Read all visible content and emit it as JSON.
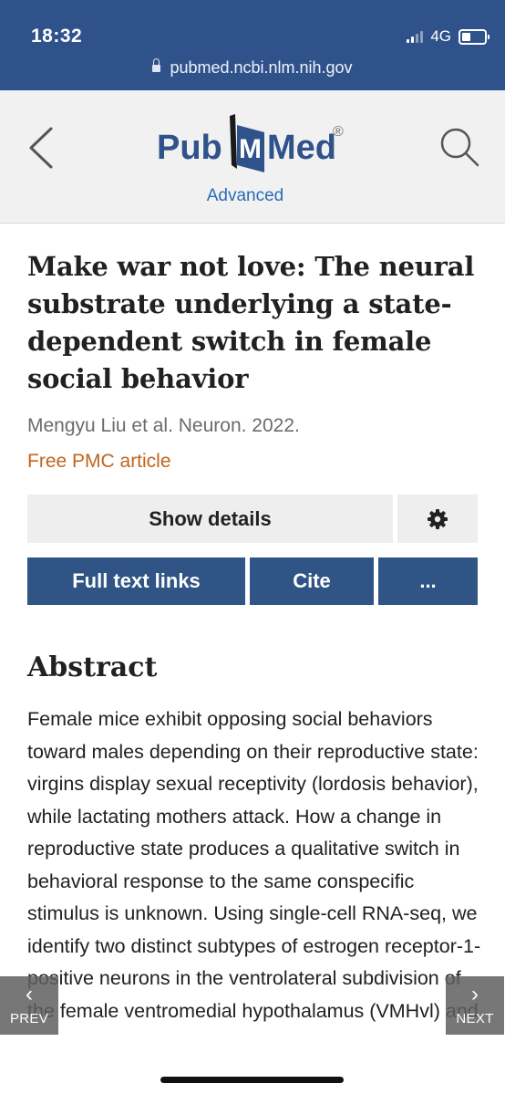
{
  "status_bar": {
    "time": "18:32",
    "network": "4G"
  },
  "browser": {
    "url": "pubmed.ncbi.nlm.nih.gov"
  },
  "header": {
    "logo_text": {
      "pub": "Pub",
      "med": "Med",
      "registered": "®"
    },
    "advanced_label": "Advanced"
  },
  "article": {
    "title": "Make war not love: The neural substrate underlying a state-dependent switch in female social behavior",
    "authors": "Mengyu Liu et al. Neuron. 2022.",
    "free_label": "Free PMC article"
  },
  "actions": {
    "show_details": "Show details",
    "full_text": "Full text links",
    "cite": "Cite",
    "more": "..."
  },
  "abstract": {
    "heading": "Abstract",
    "text": "Female mice exhibit opposing social behaviors toward males depending on their reproductive state: virgins display sexual receptivity (lordosis behavior), while lactating mothers attack. How a change in reproductive state produces a qualitative switch in behavioral response to the same conspecific stimulus is unknown. Using single-cell RNA-seq, we identify two distinct subtypes of estrogen receptor-1-positive neurons in the ventrolateral subdivision of the female ventromedial hypothalamus (VMHvl) and"
  },
  "nav": {
    "prev": "PREV",
    "next": "NEXT"
  },
  "icons": [
    "lock-icon",
    "back-icon",
    "search-icon",
    "gear-icon",
    "chevron-left-icon",
    "chevron-right-icon"
  ],
  "colors": {
    "brand_blue": "#30528a",
    "button_blue": "#305485",
    "link_blue": "#2c6bb5",
    "free_orange": "#c0641d"
  }
}
